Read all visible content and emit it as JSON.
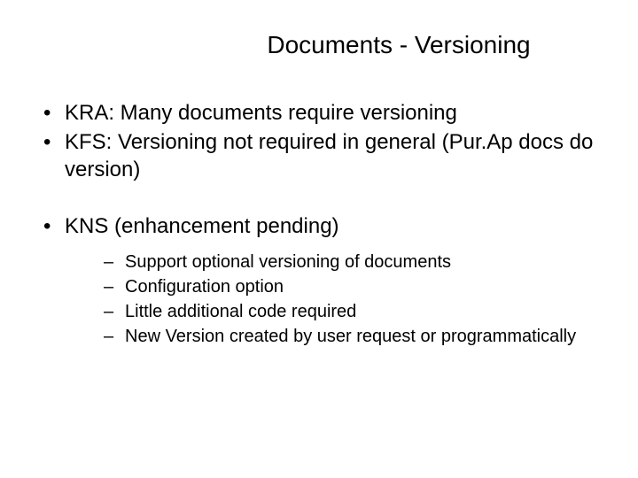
{
  "title": "Documents - Versioning",
  "bullets": {
    "b0": "KRA: Many documents require versioning",
    "b1": "KFS: Versioning not required in general (Pur.Ap docs do version)",
    "b2": "KNS (enhancement pending)"
  },
  "subbullets": {
    "s0": "Support optional versioning of documents",
    "s1": "Configuration option",
    "s2": "Little additional code required",
    "s3": "New Version created by user request or programmatically"
  }
}
